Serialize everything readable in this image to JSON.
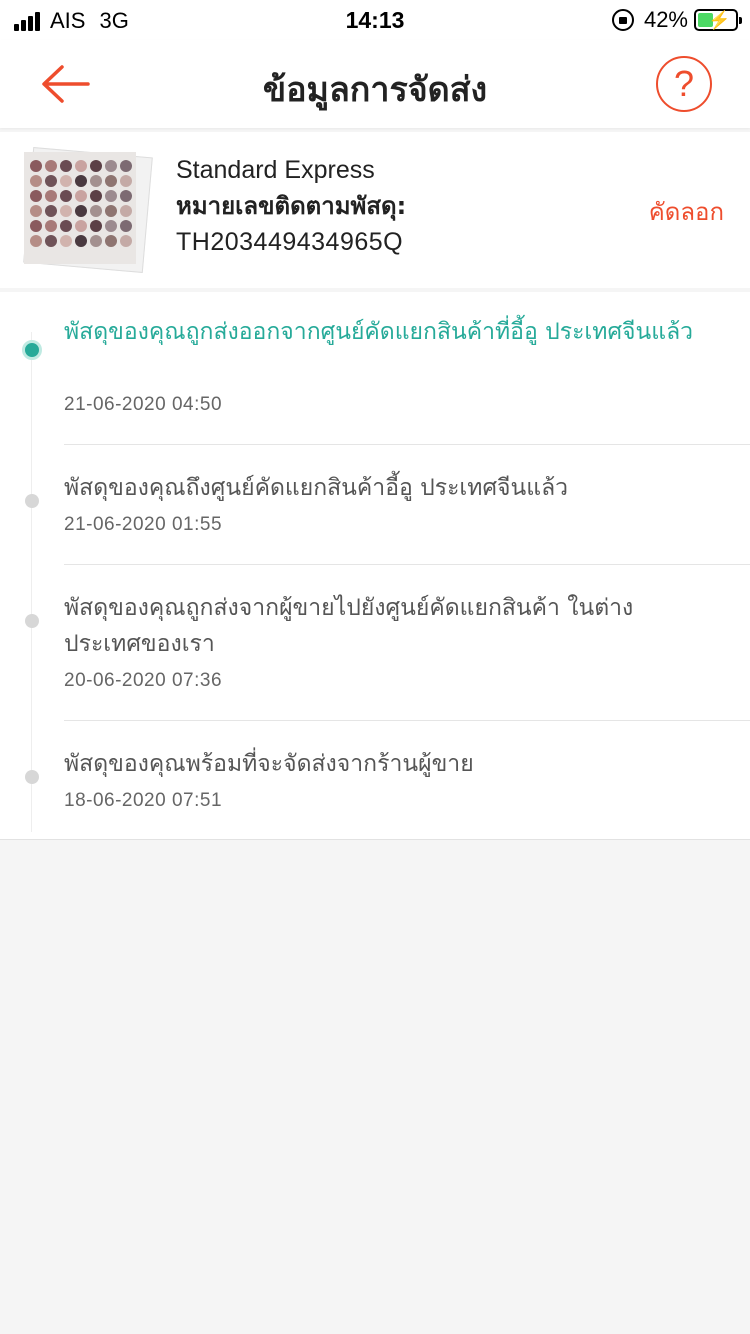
{
  "status_bar": {
    "carrier": "AIS",
    "network": "3G",
    "time": "14:13",
    "battery": "42%",
    "battery_level": 0.42,
    "signal_bars": 4
  },
  "header": {
    "title": "ข้อมูลการจัดส่ง",
    "back_icon": "back-arrow-icon",
    "help_icon": "question-mark-icon",
    "help_label": "?"
  },
  "shipment": {
    "carrier_name": "Standard Express",
    "tracking_label": "หมายเลขติดตามพัสดุ:",
    "tracking_number": "TH203449434965Q",
    "copy_label": "คัดลอก"
  },
  "timeline": [
    {
      "description": "พัสดุของคุณถูกส่งออกจากศูนย์คัดแยกสินค้าที่อี้อู ประเทศจีนแล้ว",
      "date": "21-06-2020 04:50",
      "active": true
    },
    {
      "description": "พัสดุของคุณถึงศูนย์คัดแยกสินค้าอี้อู ประเทศจีนแล้ว",
      "date": "21-06-2020 01:55",
      "active": false
    },
    {
      "description": "พัสดุของคุณถูกส่งจากผู้ขายไปยังศูนย์คัดแยกสินค้า ในต่างประเทศของเรา",
      "date": "20-06-2020 07:36",
      "active": false
    },
    {
      "description": "พัสดุของคุณพร้อมที่จะจัดส่งจากร้านผู้ขาย",
      "date": "18-06-2020 07:51",
      "active": false
    }
  ],
  "colors": {
    "accent": "#ee4d2d",
    "active_status": "#26aa99",
    "inactive_dot": "#d7d7d7",
    "battery_fill": "#4cd964"
  }
}
